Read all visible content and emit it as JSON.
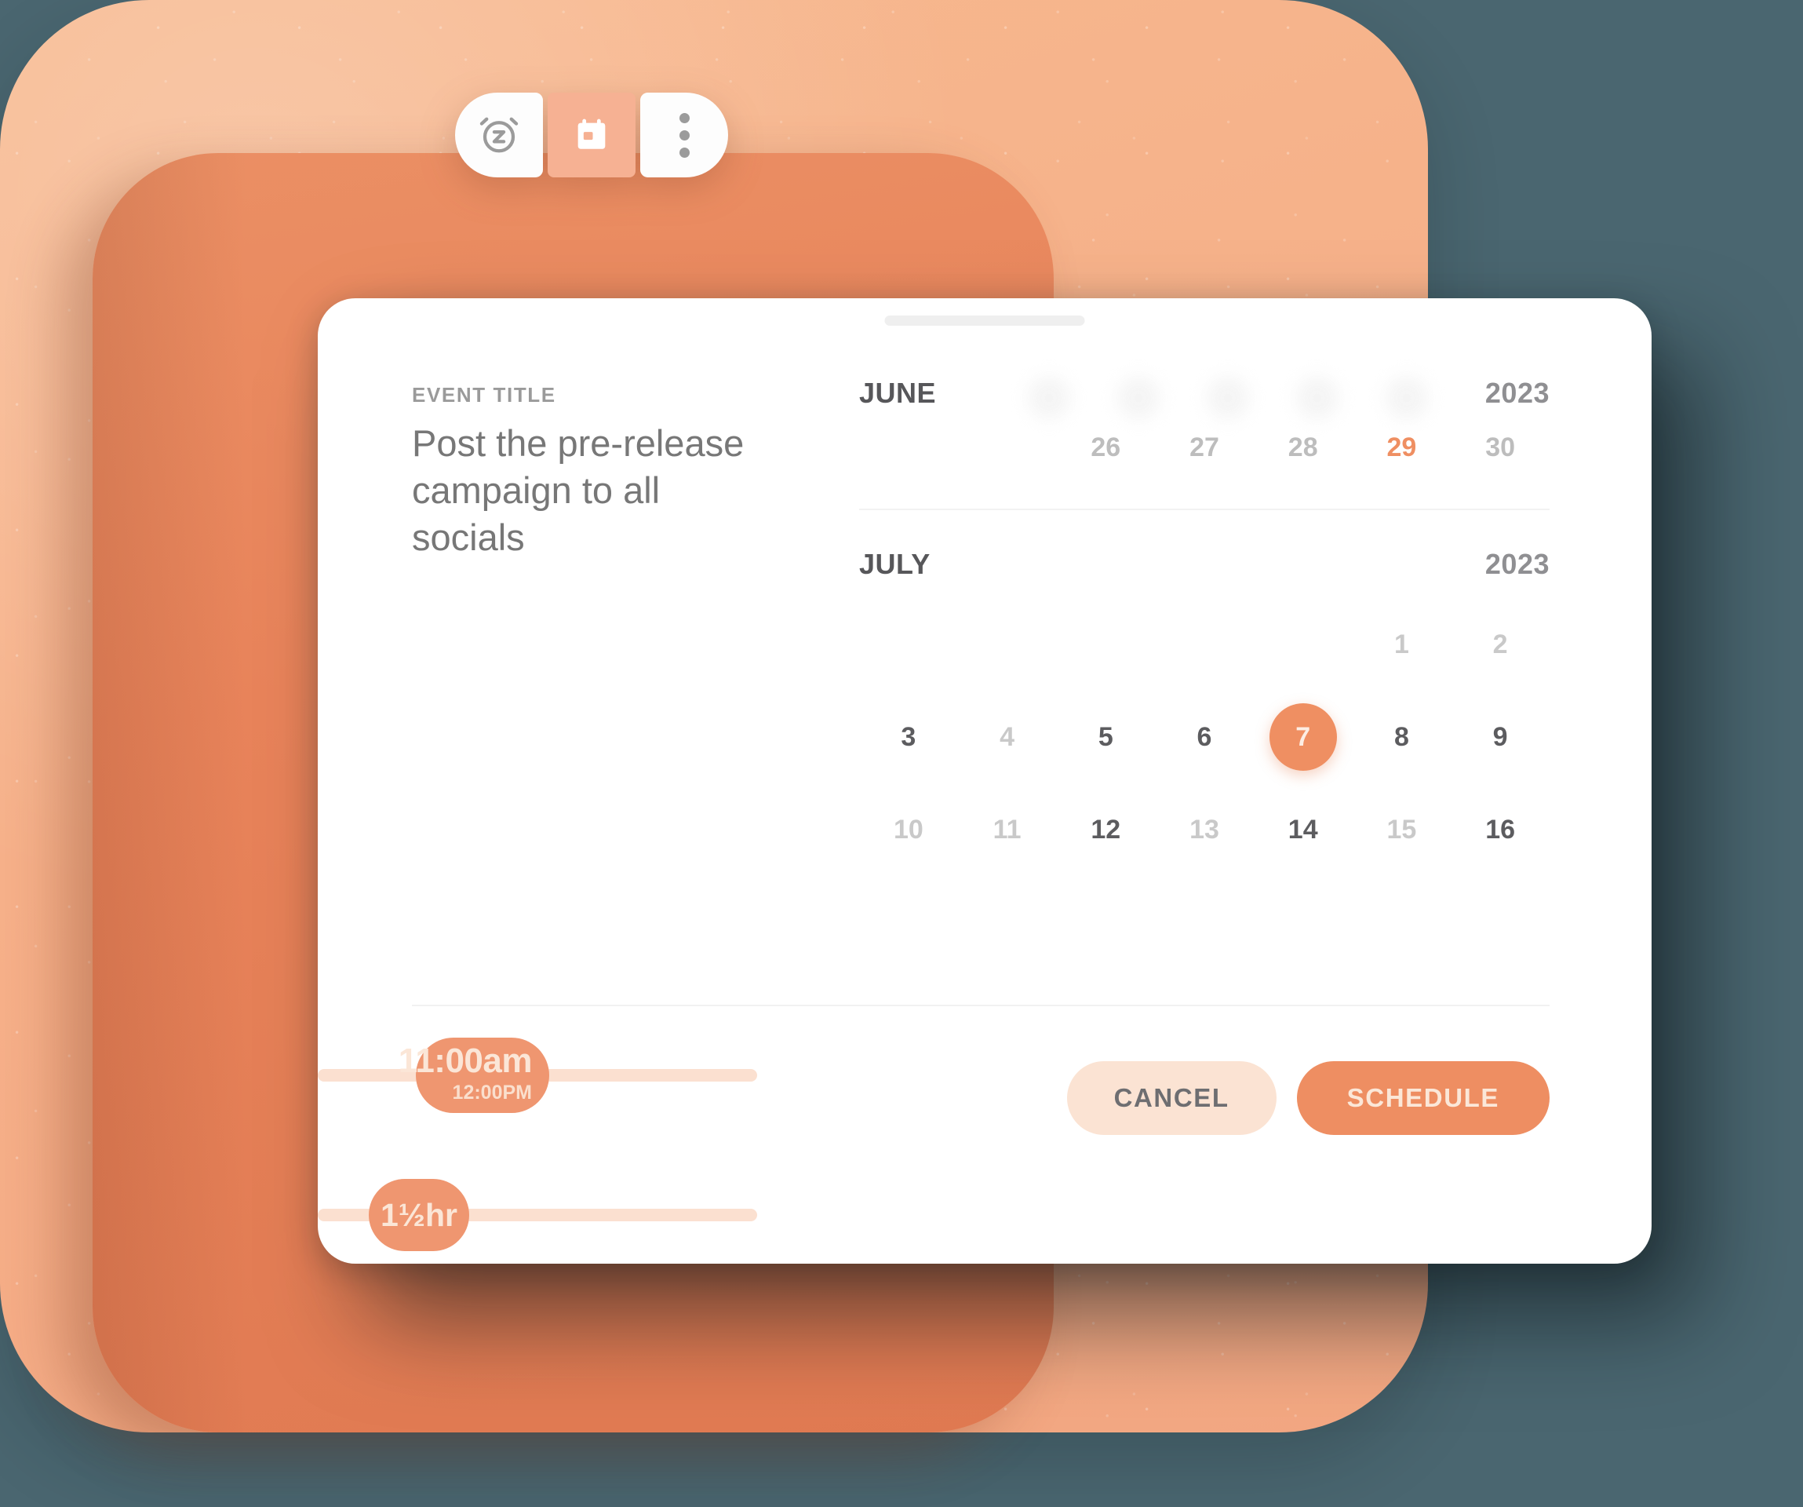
{
  "background": {
    "page_color": "#4a6670",
    "peach_card_color": "#f6b089",
    "orange_card_color": "#e8835a"
  },
  "tabbar": {
    "tabs": [
      {
        "name": "snooze-alarm",
        "icon": "alarm-snooze-icon",
        "active": false
      },
      {
        "name": "calendar",
        "icon": "calendar-icon",
        "active": true
      },
      {
        "name": "more-options",
        "icon": "more-vertical-icon",
        "active": false
      }
    ]
  },
  "sheet": {
    "handle": "drag-handle",
    "event": {
      "label": "EVENT TITLE",
      "title": "Post the pre-release campaign to all socials"
    },
    "sliders": {
      "time": {
        "primary": "11:00am",
        "secondary": "12:00PM",
        "fill_percent": 31
      },
      "duration": {
        "primary": "1½hr",
        "fill_percent": 18
      }
    },
    "calendar": {
      "accent_color": "#ef8f62",
      "months": [
        {
          "name": "JUNE",
          "year": "2023",
          "days": [
            {
              "label": "",
              "style": "empty"
            },
            {
              "label": "",
              "style": "empty"
            },
            {
              "label": "26",
              "style": "mid"
            },
            {
              "label": "27",
              "style": "mid"
            },
            {
              "label": "28",
              "style": "mid"
            },
            {
              "label": "29",
              "style": "accent"
            },
            {
              "label": "30",
              "style": "mid"
            }
          ]
        },
        {
          "name": "JULY",
          "year": "2023",
          "days": [
            {
              "label": "",
              "style": "empty"
            },
            {
              "label": "",
              "style": "empty"
            },
            {
              "label": "",
              "style": "empty"
            },
            {
              "label": "",
              "style": "empty"
            },
            {
              "label": "",
              "style": "empty"
            },
            {
              "label": "1",
              "style": "dim"
            },
            {
              "label": "2",
              "style": "dim"
            },
            {
              "label": "3",
              "style": "dark"
            },
            {
              "label": "4",
              "style": "dim"
            },
            {
              "label": "5",
              "style": "dark"
            },
            {
              "label": "6",
              "style": "dark"
            },
            {
              "label": "7",
              "style": "selected"
            },
            {
              "label": "8",
              "style": "dark"
            },
            {
              "label": "9",
              "style": "dark"
            },
            {
              "label": "10",
              "style": "dim"
            },
            {
              "label": "11",
              "style": "dim"
            },
            {
              "label": "12",
              "style": "dark"
            },
            {
              "label": "13",
              "style": "dim"
            },
            {
              "label": "14",
              "style": "dark"
            },
            {
              "label": "15",
              "style": "dim"
            },
            {
              "label": "16",
              "style": "dark"
            }
          ]
        }
      ]
    },
    "footer": {
      "cancel_label": "CANCEL",
      "schedule_label": "SCHEDULE"
    }
  }
}
